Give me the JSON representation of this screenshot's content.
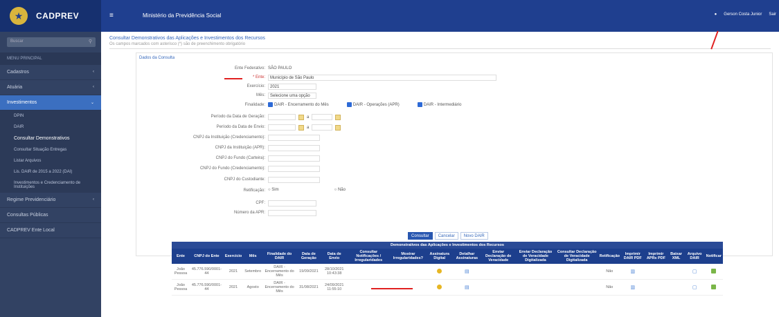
{
  "header": {
    "brand": "CADPREV",
    "ministry": "Ministério da Previdência Social",
    "user": "Gerson Costa Junior",
    "logout": "Sair"
  },
  "sidebar": {
    "search_placeholder": "Buscar",
    "menu_header": "MENU PRINCIPAL",
    "items": [
      {
        "label": "Cadastros"
      },
      {
        "label": "Atuária"
      },
      {
        "label": "Investimentos"
      }
    ],
    "subitems": [
      {
        "label": "DPIN"
      },
      {
        "label": "DAIR"
      },
      {
        "label": "Consultar Demonstrativos"
      },
      {
        "label": "Consultar Situação Entregas"
      },
      {
        "label": "Listar Arquivos"
      },
      {
        "label": "Lis. DAIR de 2015 a 2022 (DAI)"
      },
      {
        "label": "Investimentos e Credenciamento de Instituições"
      }
    ],
    "items2": [
      {
        "label": "Regime Previdenciário"
      },
      {
        "label": "Consultas Públicas"
      },
      {
        "label": "CADPREV Ente Local"
      }
    ]
  },
  "page": {
    "title": "Consultar Demonstrativos das Aplicações e Investimentos dos Recursos",
    "subtitle": "Os campos marcados com asterisco (*) são de preenchimento obrigatório",
    "panel_title": "Dados da Consulta"
  },
  "form": {
    "ente_label": "Ente Federativo:",
    "ente_value": "SÃO PAULO",
    "unidade_label": "* Ente:",
    "unidade_value": "Município de São Paulo",
    "exercicio_label": "Exercício:",
    "exercicio_value": "2021",
    "mes_label": "Mês:",
    "mes_value": "Selecione uma opção",
    "finalidade_label": "Finalidade:",
    "finalidade_opts": [
      "DAIR - Encerramento do Mês",
      "DAIR - Operações (APR)",
      "DAIR - Intermediário"
    ],
    "periodo_geracao_label": "Período da Data de Geração:",
    "periodo_envio_label": "Período da Data de Envio:",
    "ate": "a",
    "cnpj_inst_label": "CNPJ da Instituição (Credenciamento):",
    "cnpj_inst_apr_label": "CNPJ da Instituição (APR):",
    "cnpj_fundo_label": "CNPJ do Fundo (Carteira):",
    "cnpj_fundo_cred_label": "CNPJ do Fundo (Credenciamento):",
    "cnpj_custodiante_label": "CNPJ do Custodiante:",
    "retificacao_label": "Retificação:",
    "ret_sim": "Sim",
    "ret_nao": "Não",
    "cpf_label": "CPF:",
    "numero_apr_label": "Número da APR:"
  },
  "buttons": {
    "consultar": "Consultar",
    "cancelar": "Cancelar",
    "novo": "Novo DAIR"
  },
  "table": {
    "caption": "Demonstrativos das Aplicações e Investimentos dos Recursos",
    "headers": [
      "Ente",
      "CNPJ do Ente",
      "Exercício",
      "Mês",
      "Finalidade do DAIR",
      "Data de Geração",
      "Data de Envio",
      "Consultar Notificações / Irregularidades",
      "Mostrar Irregularidades?",
      "Assinatura Digital",
      "Detalhar Assinaturas",
      "Enviar Declaração de Veracidade",
      "Enviar Declaração de Veracidade Digitalizada",
      "Consultar Declaração de Veracidade Digitalizada",
      "Retificação",
      "Imprimir DAIR PDF",
      "Imprimir APRs PDF",
      "Baixar XML",
      "Arquivo DAIR",
      "Notificar"
    ],
    "rows": [
      {
        "ente": "João Pessoa",
        "cnpj": "45.776.590/0001-44",
        "exercicio": "2021",
        "mes": "Setembro",
        "finalidade": "DAIR - Encerramento do Mês",
        "geracao": "19/09/2021",
        "envio": "28/10/2021 10:43:38",
        "retificacao": "Não"
      },
      {
        "ente": "João Pessoa",
        "cnpj": "45.776.590/0001-44",
        "exercicio": "2021",
        "mes": "Agosto",
        "finalidade": "DAIR - Encerramento do Mês",
        "geracao": "31/08/2021",
        "envio": "24/09/2021 11:55:10",
        "retificacao": "Não"
      }
    ]
  }
}
